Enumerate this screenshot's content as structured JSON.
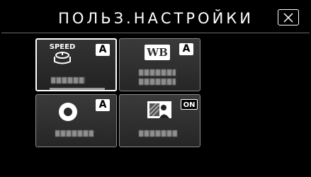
{
  "header": {
    "title": "ПОЛЬЗ.НАСТРОЙКИ",
    "close_icon": "close-x-icon"
  },
  "tiles": [
    {
      "icon": "speed-icon",
      "icon_text": "SPEED",
      "badge": "A",
      "selected": true
    },
    {
      "icon": "white-balance-icon",
      "icon_text": "WB",
      "badge": "A",
      "selected": false
    },
    {
      "icon": "focus-ring-icon",
      "badge": "A",
      "selected": false
    },
    {
      "icon": "backlight-icon",
      "badge": "ON",
      "selected": false
    }
  ],
  "colors": {
    "background": "#000000",
    "text": "#ffffff",
    "tile_border": "#8a8a8a"
  }
}
